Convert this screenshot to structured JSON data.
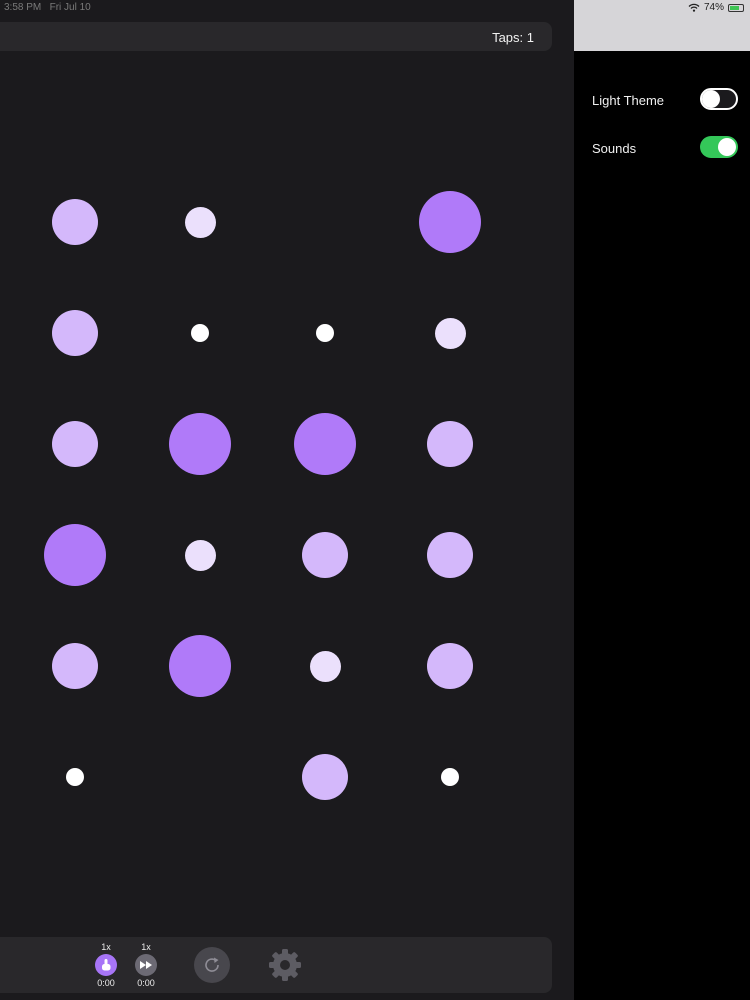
{
  "status": {
    "time": "3:58 PM",
    "date": "Fri Jul 10",
    "battery": "74%",
    "battery_level": 0.74
  },
  "header": {
    "taps_label": "Taps: 1"
  },
  "board": {
    "cols": 4,
    "rows": 6,
    "color_large": "#b07af9",
    "color_medium": "#d4b8fb",
    "color_small": "#ebe0fc",
    "color_tiny": "#ffffff",
    "cells": [
      [
        "medium",
        "small",
        "empty",
        "large"
      ],
      [
        "medium",
        "tiny",
        "tiny",
        "small"
      ],
      [
        "medium",
        "large",
        "large",
        "medium"
      ],
      [
        "large",
        "small",
        "medium",
        "medium"
      ],
      [
        "medium",
        "large",
        "small",
        "medium"
      ],
      [
        "tiny",
        "empty",
        "medium",
        "tiny"
      ]
    ]
  },
  "controls": {
    "tap_speed": "1x",
    "tap_time": "0:00",
    "ff_speed": "1x",
    "ff_time": "0:00",
    "reset_icon": "refresh-icon",
    "settings_icon": "gear-icon"
  },
  "settings": {
    "light_theme_label": "Light Theme",
    "light_theme_on": false,
    "sounds_label": "Sounds",
    "sounds_on": true,
    "toggle_on_color": "#34c759",
    "toggle_off_color": "#1b1a1d"
  }
}
